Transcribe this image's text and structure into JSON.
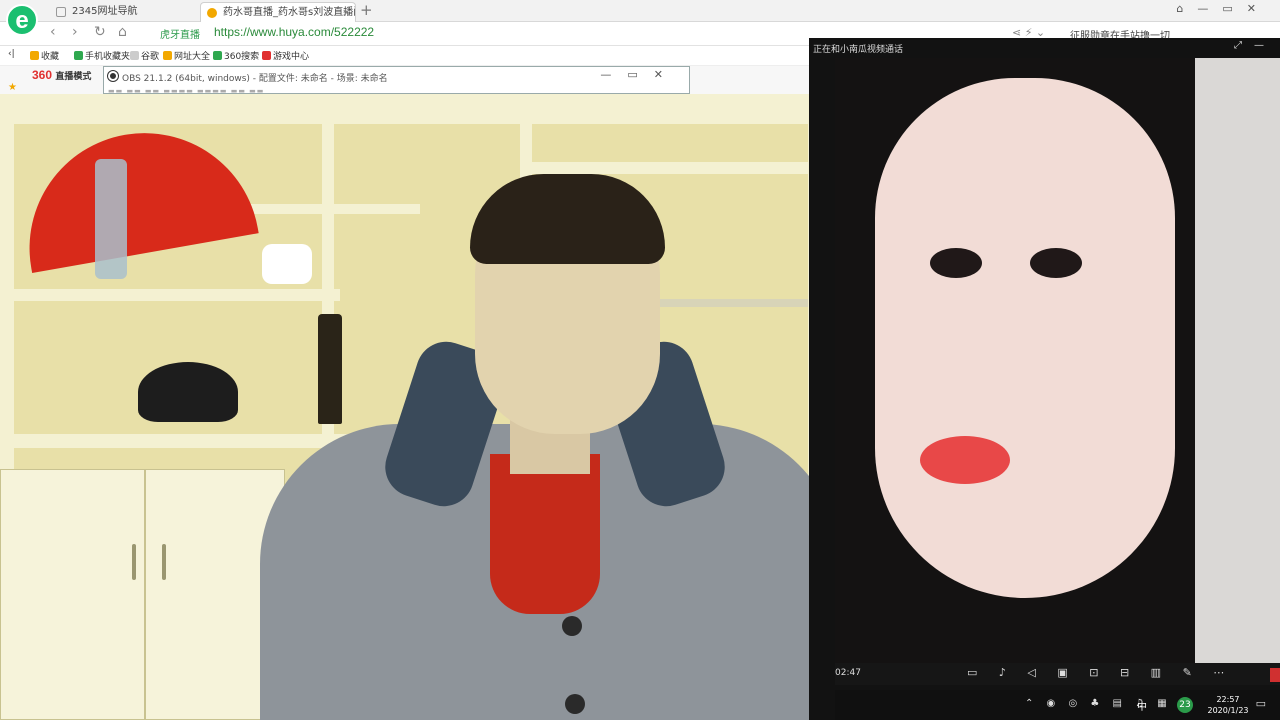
{
  "browser": {
    "logo": "e",
    "tabs": [
      {
        "label": "2345网址导航"
      },
      {
        "label": "药水哥直播_药水哥s刘波直播间..."
      }
    ],
    "new_tab": "+",
    "url_site_label": "虎牙直播",
    "url": "https://www.huya.com/522222",
    "promo": "征服勋章在手站撸一切"
  },
  "bookmarks": [
    {
      "label": "收藏",
      "color": "#f2a800"
    },
    {
      "label": "手机收藏夹",
      "color": "#2fa84f"
    },
    {
      "label": "谷歌",
      "color": "#cccccc"
    },
    {
      "label": "网址大全",
      "color": "#f2a800"
    },
    {
      "label": "360搜索",
      "color": "#2fa84f"
    },
    {
      "label": "游戏中心",
      "color": "#e03030"
    }
  ],
  "page": {
    "logo_360": "360",
    "logo_mode": "直播模式"
  },
  "obs": {
    "title": "OBS 21.1.2 (64bit, windows) - 配置文件: 未命名 - 场景: 未命名"
  },
  "call": {
    "title": "正在和小南瓜视频通话",
    "time": "02:47"
  },
  "tray": {
    "ime": "中",
    "badge": "23",
    "time": "22:57",
    "date": "2020/1/23"
  }
}
